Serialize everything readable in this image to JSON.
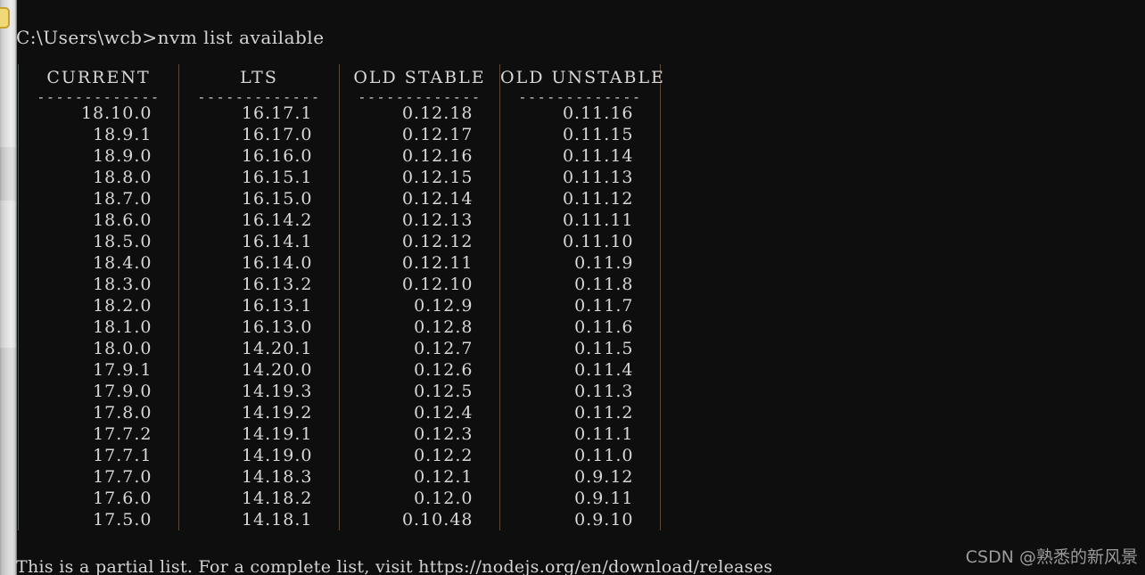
{
  "terminal": {
    "prompt_line": "C:\\Users\\wcb>nvm list available",
    "background_color": "#0e0e0e",
    "text_color": "#d4d4d4",
    "footer_line": "This is a partial list. For a complete list, visit https://nodejs.org/en/download/releases"
  },
  "scrollbar": {
    "thumb_name": "scroll-thumb",
    "thumb_color": "#f0d978",
    "track_color": "#e3e3e3"
  },
  "table": {
    "headers": [
      "CURRENT",
      "LTS",
      "OLD STABLE",
      "OLD UNSTABLE"
    ],
    "rule": "-------------",
    "border_left_color": "#3f5d63",
    "border_right_color": "#6b4322",
    "rows": [
      [
        "18.10.0",
        "16.17.1",
        "0.12.18",
        "0.11.16"
      ],
      [
        "18.9.1",
        "16.17.0",
        "0.12.17",
        "0.11.15"
      ],
      [
        "18.9.0",
        "16.16.0",
        "0.12.16",
        "0.11.14"
      ],
      [
        "18.8.0",
        "16.15.1",
        "0.12.15",
        "0.11.13"
      ],
      [
        "18.7.0",
        "16.15.0",
        "0.12.14",
        "0.11.12"
      ],
      [
        "18.6.0",
        "16.14.2",
        "0.12.13",
        "0.11.11"
      ],
      [
        "18.5.0",
        "16.14.1",
        "0.12.12",
        "0.11.10"
      ],
      [
        "18.4.0",
        "16.14.0",
        "0.12.11",
        "0.11.9"
      ],
      [
        "18.3.0",
        "16.13.2",
        "0.12.10",
        "0.11.8"
      ],
      [
        "18.2.0",
        "16.13.1",
        "0.12.9",
        "0.11.7"
      ],
      [
        "18.1.0",
        "16.13.0",
        "0.12.8",
        "0.11.6"
      ],
      [
        "18.0.0",
        "14.20.1",
        "0.12.7",
        "0.11.5"
      ],
      [
        "17.9.1",
        "14.20.0",
        "0.12.6",
        "0.11.4"
      ],
      [
        "17.9.0",
        "14.19.3",
        "0.12.5",
        "0.11.3"
      ],
      [
        "17.8.0",
        "14.19.2",
        "0.12.4",
        "0.11.2"
      ],
      [
        "17.7.2",
        "14.19.1",
        "0.12.3",
        "0.11.1"
      ],
      [
        "17.7.1",
        "14.19.0",
        "0.12.2",
        "0.11.0"
      ],
      [
        "17.7.0",
        "14.18.3",
        "0.12.1",
        "0.9.12"
      ],
      [
        "17.6.0",
        "14.18.2",
        "0.12.0",
        "0.9.11"
      ],
      [
        "17.5.0",
        "14.18.1",
        "0.10.48",
        "0.9.10"
      ]
    ]
  },
  "watermark": {
    "text": "CSDN @熟悉的新风景"
  }
}
